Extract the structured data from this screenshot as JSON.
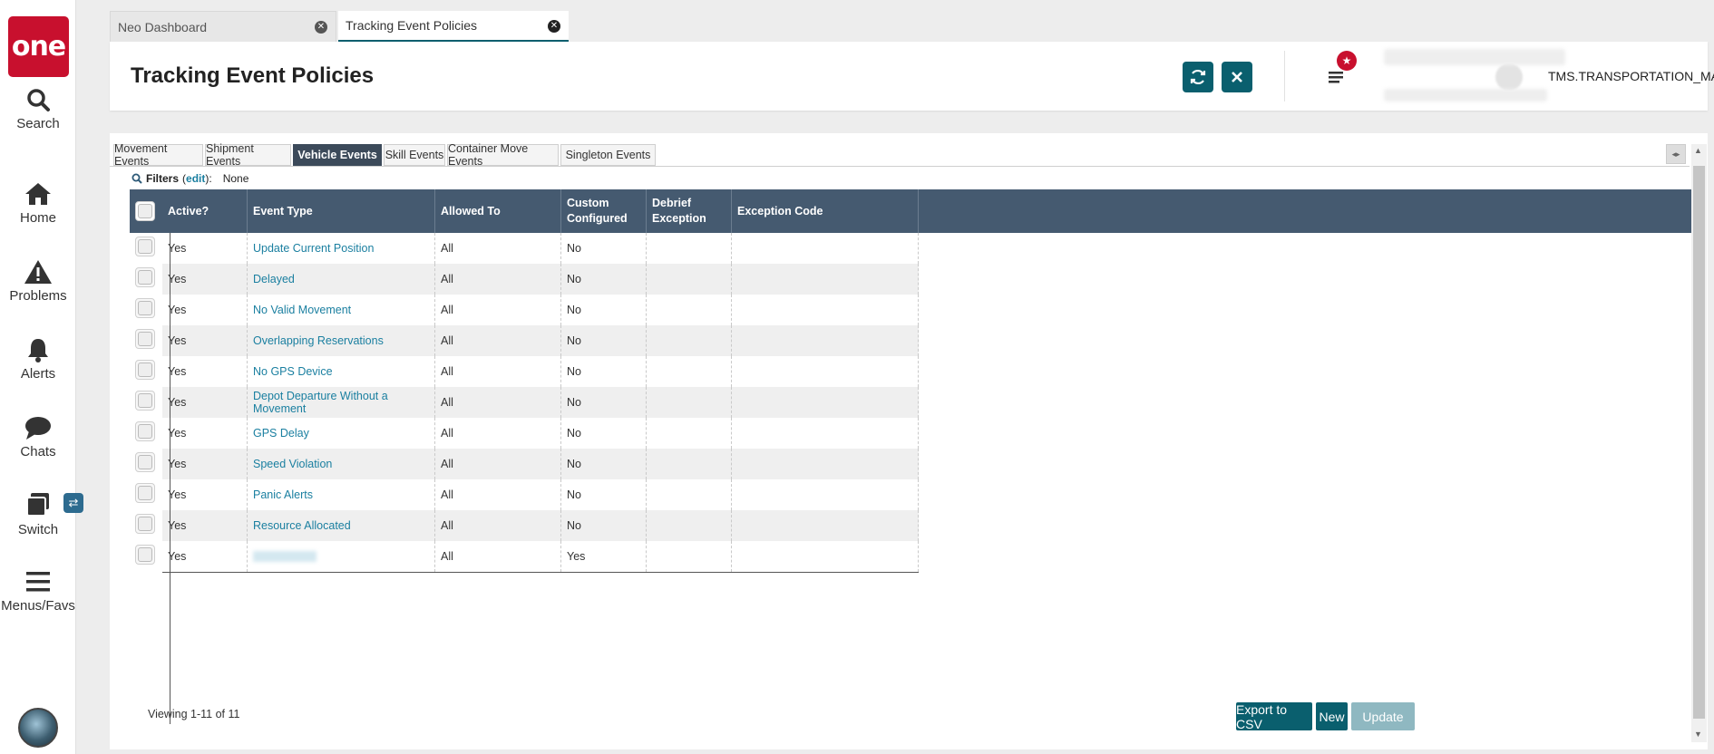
{
  "app": {
    "logo_text": "one",
    "brand_color": "#c8102e",
    "accent_color": "#0a5f6e"
  },
  "sidebar": {
    "items": [
      {
        "label": "Search",
        "icon": "search-icon"
      },
      {
        "label": "Home",
        "icon": "home-icon"
      },
      {
        "label": "Problems",
        "icon": "warning-icon"
      },
      {
        "label": "Alerts",
        "icon": "bell-icon"
      },
      {
        "label": "Chats",
        "icon": "chat-icon"
      },
      {
        "label": "Switch",
        "icon": "switch-icon"
      },
      {
        "label": "Menus/Favs",
        "icon": "hamburger-icon"
      }
    ],
    "switch_badge": "⇄"
  },
  "tabs": [
    {
      "label": "Neo Dashboard",
      "active": false
    },
    {
      "label": "Tracking Event Policies",
      "active": true
    }
  ],
  "header": {
    "title": "Tracking Event Policies",
    "user_role": "TMS.TRANSPORTATION_MANAGER"
  },
  "subtabs": [
    {
      "label": "Movement Events"
    },
    {
      "label": "Shipment Events"
    },
    {
      "label": "Vehicle Events",
      "selected": true
    },
    {
      "label": "Skill Events"
    },
    {
      "label": "Container Move Events"
    },
    {
      "label": "Singleton Events"
    }
  ],
  "filters": {
    "label": "Filters",
    "edit": "edit",
    "value": "None"
  },
  "grid": {
    "columns": [
      "Active?",
      "Event Type",
      "Allowed To",
      "Custom Configured",
      "Debrief Exception",
      "Exception Code"
    ],
    "column_lines": {
      "custom": [
        "Custom",
        "Configured"
      ],
      "debrief": [
        "Debrief",
        "Exception"
      ]
    },
    "rows": [
      {
        "active": "Yes",
        "event_type": "Update Current Position",
        "allowed_to": "All",
        "custom": "No"
      },
      {
        "active": "Yes",
        "event_type": "Delayed",
        "allowed_to": "All",
        "custom": "No"
      },
      {
        "active": "Yes",
        "event_type": "No Valid Movement",
        "allowed_to": "All",
        "custom": "No"
      },
      {
        "active": "Yes",
        "event_type": "Overlapping Reservations",
        "allowed_to": "All",
        "custom": "No"
      },
      {
        "active": "Yes",
        "event_type": "No GPS Device",
        "allowed_to": "All",
        "custom": "No"
      },
      {
        "active": "Yes",
        "event_type": "Depot Departure Without a Movement",
        "allowed_to": "All",
        "custom": "No"
      },
      {
        "active": "Yes",
        "event_type": "GPS Delay",
        "allowed_to": "All",
        "custom": "No"
      },
      {
        "active": "Yes",
        "event_type": "Speed Violation",
        "allowed_to": "All",
        "custom": "No"
      },
      {
        "active": "Yes",
        "event_type": "Panic Alerts",
        "allowed_to": "All",
        "custom": "No"
      },
      {
        "active": "Yes",
        "event_type": "Resource Allocated",
        "allowed_to": "All",
        "custom": "No"
      },
      {
        "active": "Yes",
        "event_type": "",
        "allowed_to": "All",
        "custom": "Yes"
      }
    ]
  },
  "footer": {
    "viewing": "Viewing 1-11 of 11",
    "export_label": "Export to CSV",
    "new_label": "New",
    "update_label": "Update"
  }
}
